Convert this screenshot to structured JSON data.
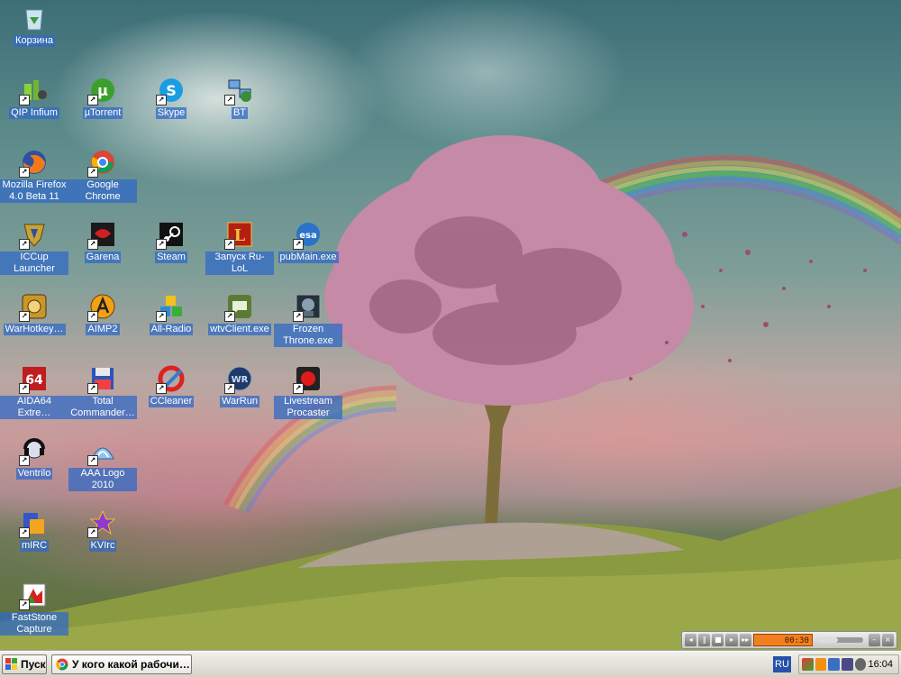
{
  "desktop": {
    "icons": [
      {
        "label": "Корзина",
        "icon": "recycle-bin-icon",
        "shortcut": false
      },
      {
        "label": "QIP Infium",
        "icon": "qip-icon",
        "shortcut": true
      },
      {
        "label": "µTorrent",
        "icon": "utorrent-icon",
        "shortcut": true
      },
      {
        "label": "Skype",
        "icon": "skype-icon",
        "shortcut": true
      },
      {
        "label": "BT",
        "icon": "network-icon",
        "shortcut": true
      },
      {
        "label": "Mozilla Firefox 4.0 Beta 11",
        "icon": "firefox-icon",
        "shortcut": true
      },
      {
        "label": "Google Chrome",
        "icon": "chrome-icon",
        "shortcut": true
      },
      {
        "label": "ICCup Launcher",
        "icon": "iccup-icon",
        "shortcut": true
      },
      {
        "label": "Garena",
        "icon": "garena-icon",
        "shortcut": true
      },
      {
        "label": "Steam",
        "icon": "steam-icon",
        "shortcut": true
      },
      {
        "label": "Запуск Ru-LoL",
        "icon": "lol-icon",
        "shortcut": true
      },
      {
        "label": "pubMain.exe",
        "icon": "esa-icon",
        "shortcut": true
      },
      {
        "label": "WarHotkey…",
        "icon": "warhotkey-icon",
        "shortcut": true
      },
      {
        "label": "AIMP2",
        "icon": "aimp-icon",
        "shortcut": true
      },
      {
        "label": "All-Radio",
        "icon": "allradio-icon",
        "shortcut": true
      },
      {
        "label": "wtvClient.exe",
        "icon": "wtv-icon",
        "shortcut": true
      },
      {
        "label": "Frozen Throne.exe",
        "icon": "frozen-throne-icon",
        "shortcut": true
      },
      {
        "label": "AIDA64 Extre…",
        "icon": "aida64-icon",
        "shortcut": true
      },
      {
        "label": "Total Commander…",
        "icon": "total-commander-icon",
        "shortcut": true
      },
      {
        "label": "CCleaner",
        "icon": "ccleaner-icon",
        "shortcut": true
      },
      {
        "label": "WarRun",
        "icon": "warrun-icon",
        "shortcut": true
      },
      {
        "label": "Livestream Procaster",
        "icon": "livestream-icon",
        "shortcut": true
      },
      {
        "label": "Ventrilo",
        "icon": "ventrilo-icon",
        "shortcut": true
      },
      {
        "label": "AAA Logo 2010",
        "icon": "aaa-logo-icon",
        "shortcut": true
      },
      {
        "label": "mIRC",
        "icon": "mirc-icon",
        "shortcut": true
      },
      {
        "label": "KVIrc",
        "icon": "kvirc-icon",
        "shortcut": true
      },
      {
        "label": "FastStone Capture",
        "icon": "faststone-icon",
        "shortcut": true
      }
    ]
  },
  "media_player": {
    "time": "00:30",
    "buttons": [
      "prev",
      "pause",
      "stop",
      "play",
      "next"
    ],
    "volume_level": 0.45
  },
  "taskbar": {
    "start_label": "Пуск",
    "active_window": "У кого какой рабочи…",
    "language": "RU",
    "clock": "16:04"
  }
}
